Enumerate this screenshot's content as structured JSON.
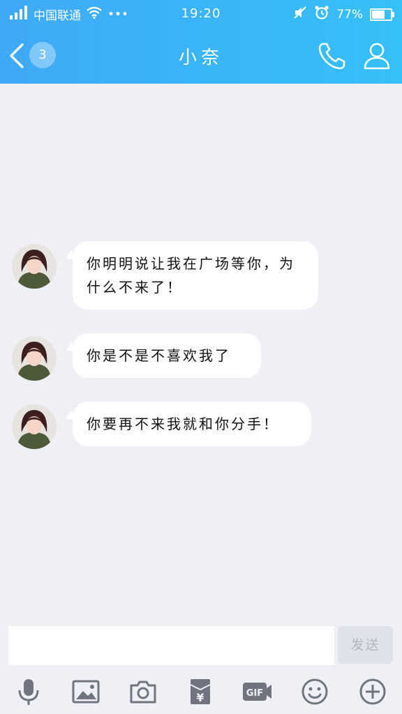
{
  "status": {
    "carrier": "中国联通",
    "more": "•••",
    "time": "19:20",
    "battery": "77%",
    "battery_level": 0.77
  },
  "nav": {
    "back_icon": "chevron-left-icon",
    "unread_count": "3",
    "title": "小奈",
    "call_icon": "phone-icon",
    "profile_icon": "person-icon"
  },
  "messages": [
    {
      "text": "你明明说让我在广场等你，为什么不来了！"
    },
    {
      "text": "你是不是不喜欢我了"
    },
    {
      "text": "你要再不来我就和你分手！"
    }
  ],
  "input": {
    "value": "",
    "send_label": "发送"
  },
  "toolbar": {
    "icons": [
      "microphone-icon",
      "image-icon",
      "camera-icon",
      "red-packet-icon",
      "gif-icon",
      "emoji-icon",
      "plus-icon"
    ],
    "gif_label": "GIF",
    "yuan_label": "¥"
  },
  "colors": {
    "header_start": "#3fa9f7",
    "header_end": "#35c0f9",
    "chat_bg": "#eef0f5",
    "icon_gray": "#6f7480"
  }
}
